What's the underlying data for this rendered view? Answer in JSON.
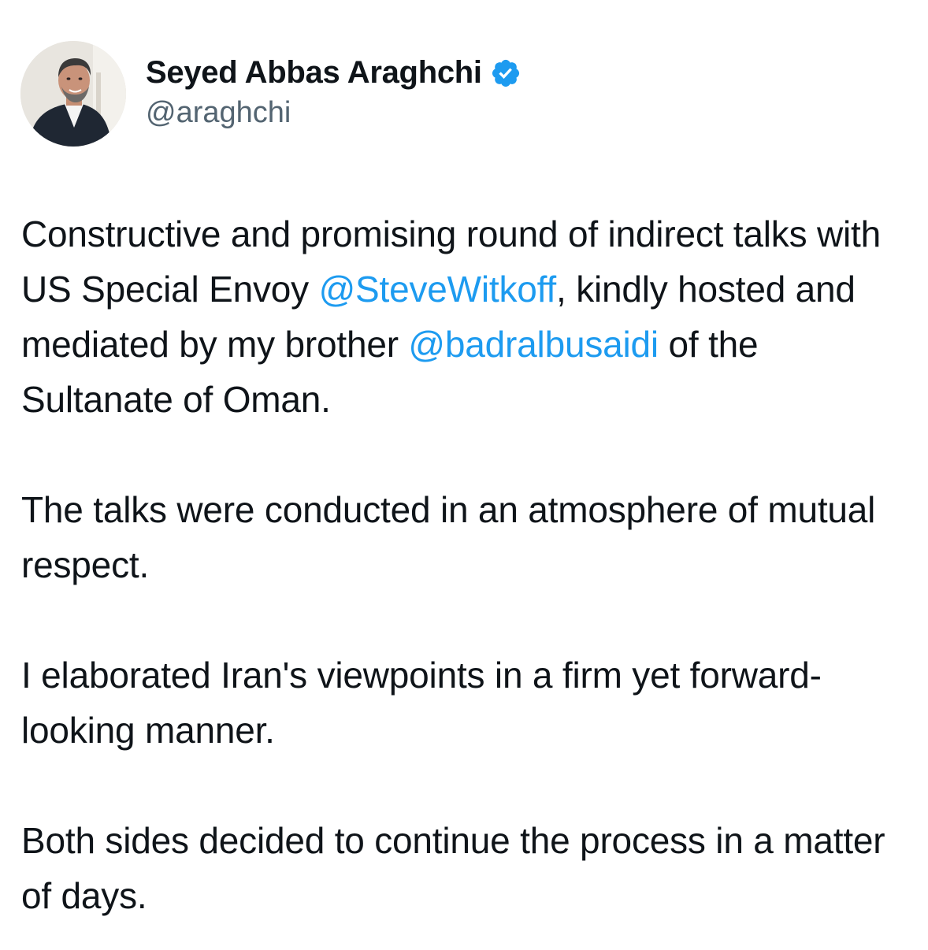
{
  "author": {
    "display_name": "Seyed Abbas Araghchi",
    "handle": "@araghchi",
    "verified": true,
    "avatar_icon": "profile-photo",
    "verified_icon": "verified-badge-icon"
  },
  "tweet": {
    "p1": {
      "seg1": "Constructive and promising round of indirect talks with US Special Envoy ",
      "mention1": "@SteveWitkoff",
      "seg2": ", kindly hosted and mediated by my brother ",
      "mention2": "@badralbusaidi",
      "seg3": " of the Sultanate of Oman."
    },
    "p2": "The talks were conducted in an atmosphere of mutual respect.",
    "p3": "I elaborated Iran's viewpoints in a firm yet forward-looking manner.",
    "p4": "Both sides decided to continue the process in a matter of days."
  },
  "colors": {
    "text": "#0f1419",
    "secondary_text": "#536471",
    "link": "#1d9bf0",
    "verified_badge": "#1d9bf0",
    "background": "#ffffff"
  }
}
